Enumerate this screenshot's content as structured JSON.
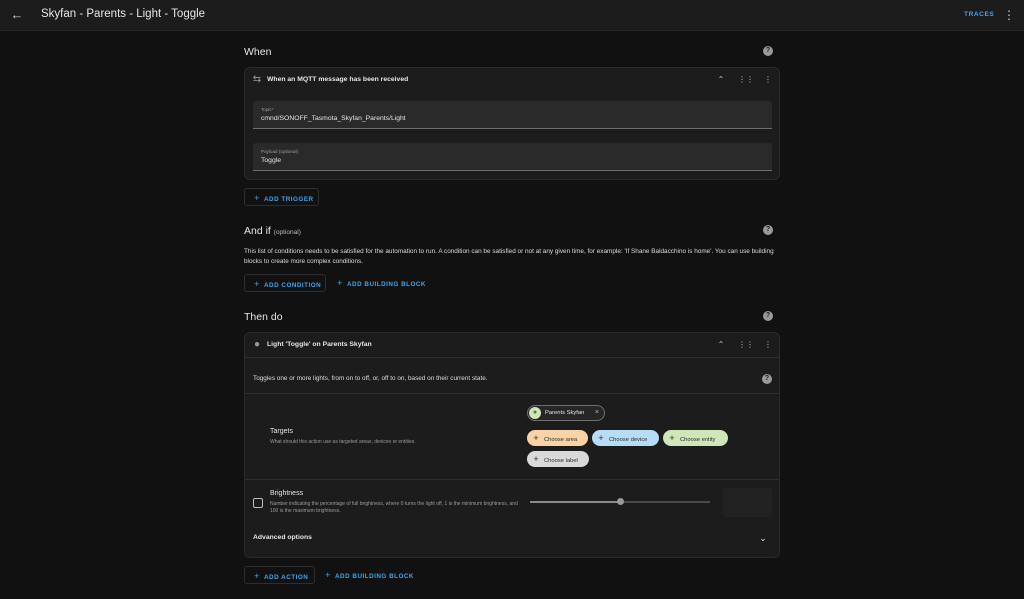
{
  "header": {
    "back_icon": "arrow-left-icon",
    "title": "Skyfan - Parents - Light - Toggle",
    "traces_label": "TRACES",
    "menu_icon": "more-vertical-icon"
  },
  "when": {
    "title": "When",
    "trigger": {
      "title": "When an MQTT message has been received",
      "icon": "swap-arrows-icon",
      "topic_label": "Topic*",
      "topic_value": "cmnd/SONOFF_Tasmota_Skyfan_Parents/Light",
      "payload_label": "Payload (optional)",
      "payload_value": "Toggle"
    },
    "add_trigger_label": "ADD TRIGGER"
  },
  "and_if": {
    "title": "And if",
    "optional_label": "(optional)",
    "description": "This list of conditions needs to be satisfied for the automation to run. A condition can be satisfied or not at any given time, for example: 'If Shane Baldacchino is home'. You can use building blocks to create more complex conditions.",
    "add_condition_label": "ADD CONDITION",
    "add_building_block_label": "ADD BUILDING BLOCK"
  },
  "then_do": {
    "title": "Then do",
    "action": {
      "title": "Light 'Toggle' on Parents Skyfan",
      "icon": "lightbulb-icon",
      "description": "Toggles one or more lights, from on to off, or, off to on, based on their current state.",
      "targets_label": "Targets",
      "targets_description": "What should this action use as targeted areas, devices or entities.",
      "selected_entity": "Parents Skyfan",
      "choose_area": "Choose area",
      "choose_device": "Choose device",
      "choose_entity": "Choose entity",
      "choose_label": "Choose label",
      "brightness_label": "Brightness",
      "brightness_description": "Number indicating the percentage of full brightness, where 0 turns the light off, 1 is the minimum brightness, and 100 is the maximum brightness.",
      "brightness_slider_fraction": 0.5,
      "advanced_options_label": "Advanced options"
    },
    "add_action_label": "ADD ACTION",
    "add_building_block_label": "ADD BUILDING BLOCK"
  },
  "colors": {
    "accent": "#3ea6f2",
    "area_chip": "#f9d2a5",
    "device_chip": "#b7dcf5",
    "entity_chip": "#cfe6b8",
    "label_chip": "#d9d9d9"
  }
}
